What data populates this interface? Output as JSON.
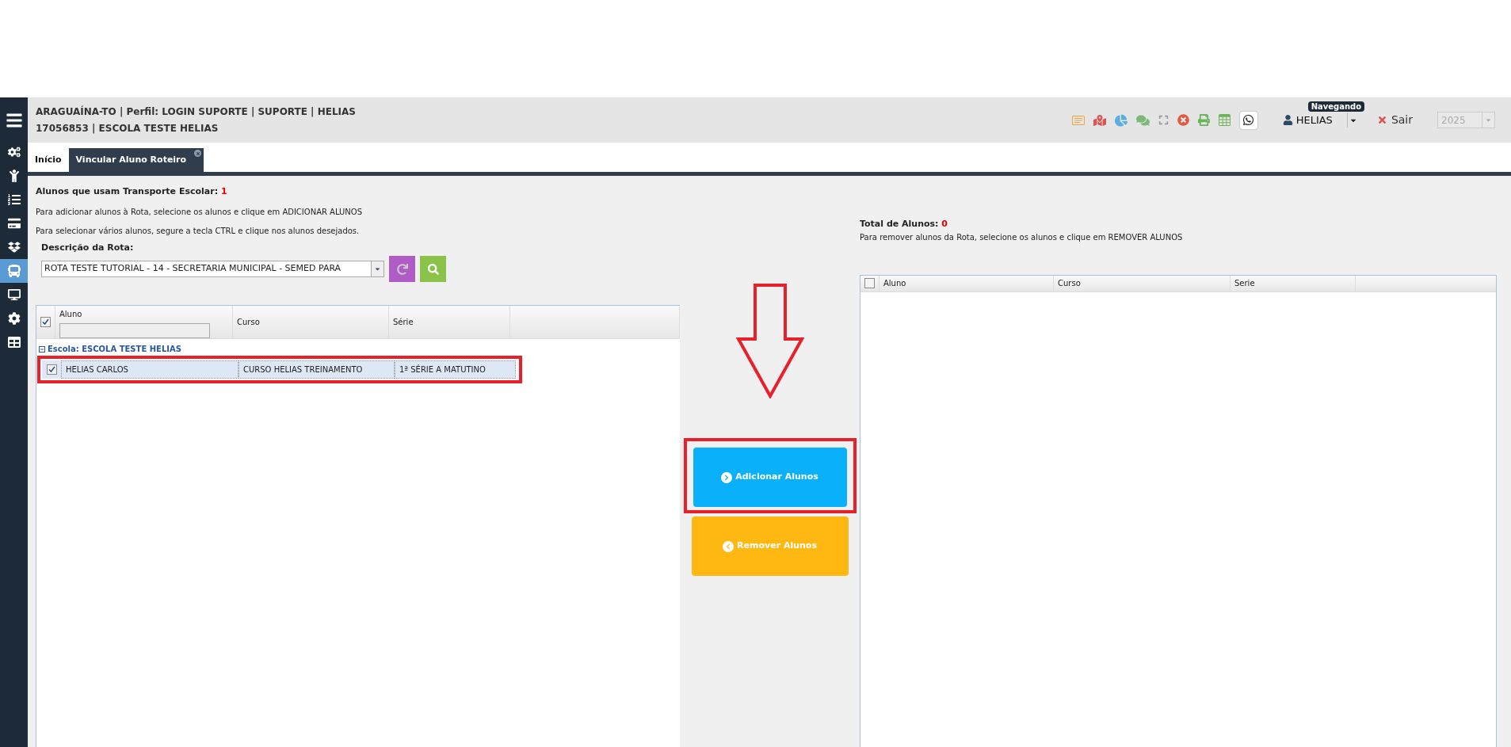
{
  "header": {
    "line1": "ARAGUAÍNA-TO | Perfil: LOGIN SUPORTE | SUPORTE | HELIAS",
    "line2": "17056853 | ESCOLA TESTE HELIAS",
    "user": "HELIAS",
    "tooltip": "Navegando",
    "logout": "Sair",
    "year": "2025"
  },
  "sidebar": {
    "items": [
      {
        "selected": false
      },
      {
        "selected": false
      },
      {
        "selected": false
      },
      {
        "selected": false
      },
      {
        "selected": false
      },
      {
        "selected": true
      },
      {
        "selected": false
      },
      {
        "selected": false
      },
      {
        "selected": false
      }
    ]
  },
  "tabs": [
    {
      "label": "Início",
      "selected": false,
      "closable": false
    },
    {
      "label": "Vincular Aluno Roteiro",
      "selected": true,
      "closable": true
    }
  ],
  "left": {
    "count_label": "Alunos que usam Transporte Escolar:",
    "count": "1",
    "hint1": "Para adicionar alunos à Rota, selecione os alunos e clique em ADICIONAR ALUNOS",
    "hint2": "Para selecionar vários alunos, segure a tecla CTRL e clique nos alunos desejados.",
    "route_label": "Descrição da Rota:",
    "route_value": "ROTA TESTE TUTORIAL - 14 - SECRETARIA MUNICIPAL - SEMED PARA",
    "table": {
      "all_checked": true,
      "columns": [
        "Aluno",
        "Curso",
        "Série"
      ],
      "group": "Escola: ESCOLA TESTE HELIAS",
      "rows": [
        {
          "checked": true,
          "selected": true,
          "cells": [
            "HELIAS CARLOS",
            "CURSO HELIAS TREINAMENTO",
            "1ª SÉRIE A MATUTINO"
          ]
        }
      ]
    }
  },
  "buttons": [
    {
      "kind": "add",
      "label": "Adicionar Alunos"
    },
    {
      "kind": "remove",
      "label": "Remover Alunos"
    }
  ],
  "right": {
    "count_label": "Total de Alunos:",
    "count": "0",
    "hint": "Para remover alunos da Rota, selecione os alunos e clique em REMOVER ALUNOS",
    "table": {
      "all_checked": false,
      "columns": [
        "Aluno",
        "Curso",
        "Serie"
      ]
    }
  }
}
